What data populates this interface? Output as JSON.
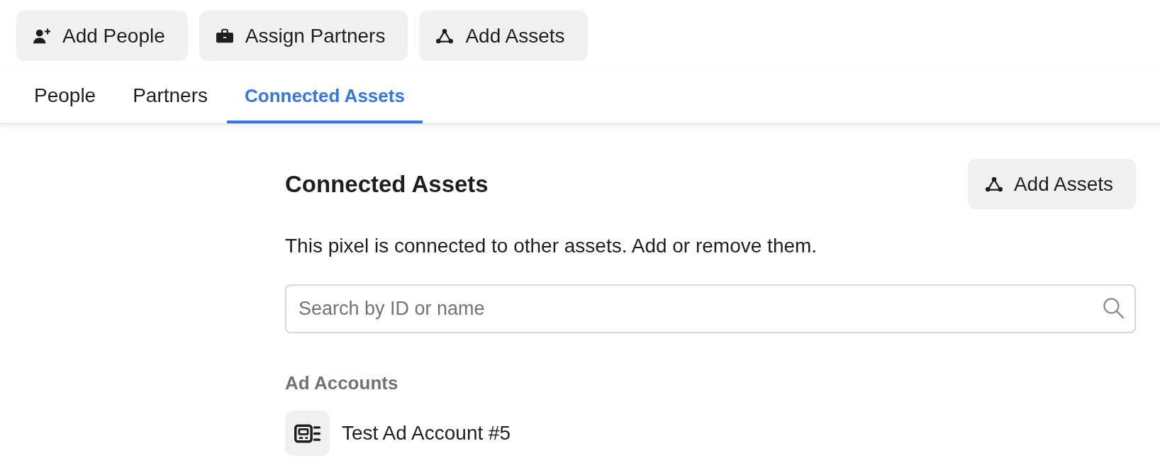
{
  "toolbar": [
    {
      "kind": "person",
      "label": "Add People"
    },
    {
      "kind": "briefcase",
      "label": "Assign Partners"
    },
    {
      "kind": "nodes",
      "label": "Add Assets"
    }
  ],
  "tabs": [
    {
      "label": "People",
      "selected": false
    },
    {
      "label": "Partners",
      "selected": false
    },
    {
      "label": "Connected Assets",
      "selected": true
    }
  ],
  "section": {
    "title": "Connected Assets",
    "action": {
      "kind": "nodes",
      "label": "Add Assets"
    },
    "description": "This pixel is connected to other assets. Add or remove them.",
    "search": {
      "placeholder": "Search by ID or name"
    },
    "groups": [
      {
        "title": "Ad Accounts",
        "items": [
          {
            "kind": "account",
            "name": "Test Ad Account #5"
          }
        ]
      }
    ]
  }
}
